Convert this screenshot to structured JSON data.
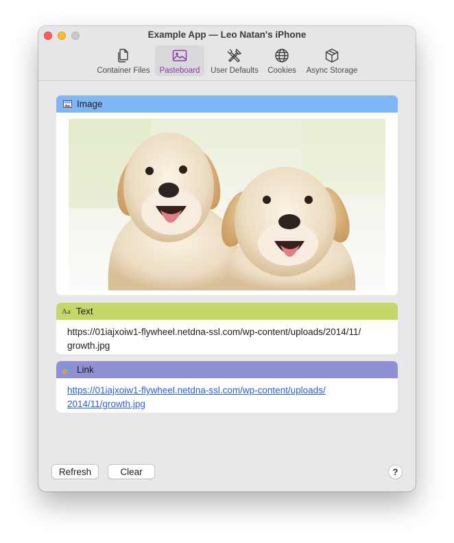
{
  "window": {
    "title": "Example App — Leo Natan's iPhone"
  },
  "toolbar": {
    "items": [
      {
        "label": "Container Files",
        "icon": "files-icon"
      },
      {
        "label": "Pasteboard",
        "icon": "photo-icon",
        "selected": true
      },
      {
        "label": "User Defaults",
        "icon": "tools-icon"
      },
      {
        "label": "Cookies",
        "icon": "globe-icon"
      },
      {
        "label": "Async Storage",
        "icon": "box-icon"
      }
    ]
  },
  "items": {
    "image": {
      "label": "Image",
      "color": "#7fb6f5"
    },
    "text": {
      "label": "Text",
      "icon_glyph": "Aa",
      "line1": "https://01iajxoiw1-flywheel.netdna-ssl.com/wp-content/uploads/2014/11/",
      "line2": "growth.jpg",
      "color": "#c4d86a"
    },
    "link": {
      "label": "Link",
      "line1": "https://01iajxoiw1-flywheel.netdna-ssl.com/wp-content/uploads/",
      "line2": "2014/11/growth.jpg",
      "color": "#9090d4"
    }
  },
  "footer": {
    "refresh_label": "Refresh",
    "clear_label": "Clear",
    "help_label": "?"
  },
  "colors": {
    "accent": "#8a3aa0",
    "link": "#2a5fd4"
  }
}
